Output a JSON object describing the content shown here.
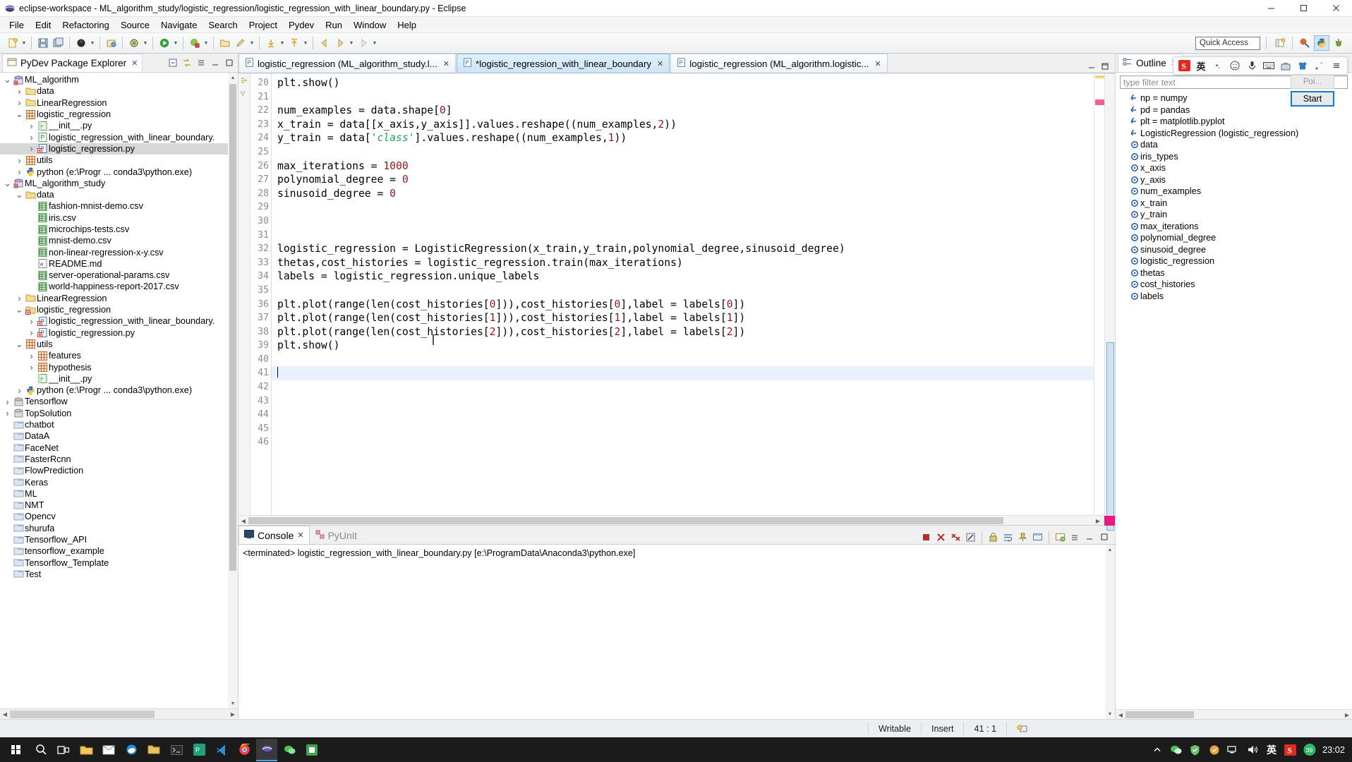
{
  "window": {
    "title": "eclipse-workspace - ML_algorithm_study/logistic_regression/logistic_regression_with_linear_boundary.py - Eclipse",
    "minimize": "–",
    "maximize": "□",
    "close": "✕"
  },
  "menubar": [
    "File",
    "Edit",
    "Refactoring",
    "Source",
    "Navigate",
    "Search",
    "Project",
    "Pydev",
    "Run",
    "Window",
    "Help"
  ],
  "toolbar": {
    "quick_access_placeholder": "Quick Access",
    "buttons": [
      "new-wizard-icon",
      "save-icon",
      "save-all-icon",
      "debug-icon",
      "run-external-tools-icon",
      "debug-run-icon",
      "run-icon",
      "coverage-icon",
      "open-folder-icon",
      "pin-icon",
      "next-annotation-icon",
      "previous-annotation-icon",
      "back-icon",
      "forward-icon"
    ],
    "perspectives": [
      "open-perspective-icon",
      "java-perspective-icon",
      "pydev-perspective-icon",
      "debug-perspective-icon"
    ]
  },
  "package_explorer": {
    "title": "PyDev Package Explorer",
    "close_x": "✕",
    "actions": [
      "collapse-all-icon",
      "link-with-editor-icon",
      "view-menu-icon",
      "minimize-icon",
      "maximize-icon"
    ],
    "items": [
      {
        "label": "ML_algorithm",
        "indent": 0,
        "arrow": "v",
        "icon": "pydev-project-icon",
        "selected": false
      },
      {
        "label": "data",
        "indent": 1,
        "arrow": ">",
        "icon": "folder-icon",
        "selected": false
      },
      {
        "label": "LinearRegression",
        "indent": 1,
        "arrow": ">",
        "icon": "folder-icon",
        "selected": false
      },
      {
        "label": "logistic_regression",
        "indent": 1,
        "arrow": "v",
        "icon": "package-icon",
        "selected": false
      },
      {
        "label": "__init__.py",
        "indent": 2,
        "arrow": ">",
        "icon": "python-init-icon",
        "selected": false
      },
      {
        "label": "logistic_regression_with_linear_boundary.",
        "indent": 2,
        "arrow": ">",
        "icon": "python-file-icon",
        "selected": false
      },
      {
        "label": "logistic_regression.py",
        "indent": 2,
        "arrow": ">",
        "icon": "python-error-icon",
        "selected": true
      },
      {
        "label": "utils",
        "indent": 1,
        "arrow": ">",
        "icon": "package-icon",
        "selected": false
      },
      {
        "label": "python  (e:\\Progr ... conda3\\python.exe)",
        "indent": 1,
        "arrow": ">",
        "icon": "python-interp-icon",
        "selected": false
      },
      {
        "label": "ML_algorithm_study",
        "indent": 0,
        "arrow": "v",
        "icon": "pydev-project-icon",
        "selected": false
      },
      {
        "label": "data",
        "indent": 1,
        "arrow": "v",
        "icon": "folder-icon",
        "selected": false
      },
      {
        "label": "fashion-mnist-demo.csv",
        "indent": 2,
        "arrow": "",
        "icon": "csv-icon",
        "selected": false
      },
      {
        "label": "iris.csv",
        "indent": 2,
        "arrow": "",
        "icon": "csv-icon",
        "selected": false
      },
      {
        "label": "microchips-tests.csv",
        "indent": 2,
        "arrow": "",
        "icon": "csv-icon",
        "selected": false
      },
      {
        "label": "mnist-demo.csv",
        "indent": 2,
        "arrow": "",
        "icon": "csv-icon",
        "selected": false
      },
      {
        "label": "non-linear-regression-x-y.csv",
        "indent": 2,
        "arrow": "",
        "icon": "csv-icon",
        "selected": false
      },
      {
        "label": "README.md",
        "indent": 2,
        "arrow": "",
        "icon": "md-icon",
        "selected": false
      },
      {
        "label": "server-operational-params.csv",
        "indent": 2,
        "arrow": "",
        "icon": "csv-icon",
        "selected": false
      },
      {
        "label": "world-happiness-report-2017.csv",
        "indent": 2,
        "arrow": "",
        "icon": "csv-icon",
        "selected": false
      },
      {
        "label": "LinearRegression",
        "indent": 1,
        "arrow": ">",
        "icon": "folder-icon",
        "selected": false
      },
      {
        "label": "logistic_regression",
        "indent": 1,
        "arrow": "v",
        "icon": "folder-error-icon",
        "selected": false
      },
      {
        "label": "logistic_regression_with_linear_boundary.",
        "indent": 2,
        "arrow": ">",
        "icon": "python-error-icon",
        "selected": false
      },
      {
        "label": "logistic_regression.py",
        "indent": 2,
        "arrow": ">",
        "icon": "python-error-icon",
        "selected": false
      },
      {
        "label": "utils",
        "indent": 1,
        "arrow": "v",
        "icon": "package-icon",
        "selected": false
      },
      {
        "label": "features",
        "indent": 2,
        "arrow": ">",
        "icon": "package-icon",
        "selected": false
      },
      {
        "label": "hypothesis",
        "indent": 2,
        "arrow": ">",
        "icon": "package-icon",
        "selected": false
      },
      {
        "label": "__init__.py",
        "indent": 2,
        "arrow": "",
        "icon": "python-init-icon",
        "selected": false
      },
      {
        "label": "python  (e:\\Progr ... conda3\\python.exe)",
        "indent": 1,
        "arrow": ">",
        "icon": "python-interp-icon",
        "selected": false
      },
      {
        "label": "Tensorflow",
        "indent": 0,
        "arrow": ">",
        "icon": "closed-project-icon",
        "selected": false
      },
      {
        "label": "TopSolution",
        "indent": 0,
        "arrow": ">",
        "icon": "closed-project-icon",
        "selected": false
      },
      {
        "label": "chatbot",
        "indent": 0,
        "arrow": "",
        "icon": "folder-plain-icon",
        "selected": false
      },
      {
        "label": "DataA",
        "indent": 0,
        "arrow": "",
        "icon": "folder-plain-icon",
        "selected": false
      },
      {
        "label": "FaceNet",
        "indent": 0,
        "arrow": "",
        "icon": "folder-plain-icon",
        "selected": false
      },
      {
        "label": "FasterRcnn",
        "indent": 0,
        "arrow": "",
        "icon": "folder-plain-icon",
        "selected": false
      },
      {
        "label": "FlowPrediction",
        "indent": 0,
        "arrow": "",
        "icon": "folder-plain-icon",
        "selected": false
      },
      {
        "label": "Keras",
        "indent": 0,
        "arrow": "",
        "icon": "folder-plain-icon",
        "selected": false
      },
      {
        "label": "ML",
        "indent": 0,
        "arrow": "",
        "icon": "folder-plain-icon",
        "selected": false
      },
      {
        "label": "NMT",
        "indent": 0,
        "arrow": "",
        "icon": "folder-plain-icon",
        "selected": false
      },
      {
        "label": "Opencv",
        "indent": 0,
        "arrow": "",
        "icon": "folder-plain-icon",
        "selected": false
      },
      {
        "label": "shurufa",
        "indent": 0,
        "arrow": "",
        "icon": "folder-plain-icon",
        "selected": false
      },
      {
        "label": "Tensorflow_API",
        "indent": 0,
        "arrow": "",
        "icon": "folder-plain-icon",
        "selected": false
      },
      {
        "label": "tensorflow_example",
        "indent": 0,
        "arrow": "",
        "icon": "folder-plain-icon",
        "selected": false
      },
      {
        "label": "Tensorflow_Template",
        "indent": 0,
        "arrow": "",
        "icon": "folder-plain-icon",
        "selected": false
      },
      {
        "label": "Test",
        "indent": 0,
        "arrow": "",
        "icon": "folder-plain-icon",
        "selected": false
      }
    ]
  },
  "editor": {
    "tabs": [
      {
        "label": "logistic_regression (ML_algorithm_study.l...",
        "active": false,
        "dirty": false,
        "close": "✕"
      },
      {
        "label": "*logistic_regression_with_linear_boundary",
        "active": true,
        "dirty": true,
        "close": "✕"
      },
      {
        "label": "logistic_regression (ML_algorithm.logistic...",
        "active": false,
        "dirty": false,
        "close": "✕"
      }
    ],
    "minimize": "—",
    "maximize": "□",
    "first_line_number": 20,
    "current_line": 41,
    "lines": [
      {
        "n": 20,
        "tokens": [
          {
            "t": "plt.show()",
            "c": ""
          }
        ]
      },
      {
        "n": 21,
        "tokens": []
      },
      {
        "n": 22,
        "tokens": [
          {
            "t": "num_examples = data.shape[",
            "c": ""
          },
          {
            "t": "0",
            "c": "num"
          },
          {
            "t": "]",
            "c": ""
          }
        ]
      },
      {
        "n": 23,
        "tokens": [
          {
            "t": "x_train = data[[x_axis,y_axis]].values.reshape((num_examples,",
            "c": ""
          },
          {
            "t": "2",
            "c": "num"
          },
          {
            "t": "))",
            "c": ""
          }
        ]
      },
      {
        "n": 24,
        "tokens": [
          {
            "t": "y_train = data[",
            "c": ""
          },
          {
            "t": "'class'",
            "c": "str"
          },
          {
            "t": "].values.reshape((num_examples,",
            "c": ""
          },
          {
            "t": "1",
            "c": "num"
          },
          {
            "t": "))",
            "c": ""
          }
        ]
      },
      {
        "n": 25,
        "tokens": []
      },
      {
        "n": 26,
        "tokens": [
          {
            "t": "max_iterations = ",
            "c": ""
          },
          {
            "t": "1000",
            "c": "num"
          }
        ]
      },
      {
        "n": 27,
        "tokens": [
          {
            "t": "polynomial_degree = ",
            "c": ""
          },
          {
            "t": "0",
            "c": "num"
          }
        ]
      },
      {
        "n": 28,
        "tokens": [
          {
            "t": "sinusoid_degree = ",
            "c": ""
          },
          {
            "t": "0",
            "c": "num"
          }
        ]
      },
      {
        "n": 29,
        "tokens": []
      },
      {
        "n": 30,
        "tokens": []
      },
      {
        "n": 31,
        "tokens": []
      },
      {
        "n": 32,
        "tokens": [
          {
            "t": "logistic_regression = LogisticRegression(x_train,y_train,polynomial_degree,sinusoid_degree)",
            "c": ""
          }
        ]
      },
      {
        "n": 33,
        "tokens": [
          {
            "t": "thetas,cost_histories = logistic_regression.train(max_iterations)",
            "c": ""
          }
        ]
      },
      {
        "n": 34,
        "tokens": [
          {
            "t": "labels = logistic_regression.unique_labels",
            "c": ""
          }
        ]
      },
      {
        "n": 35,
        "tokens": []
      },
      {
        "n": 36,
        "tokens": [
          {
            "t": "plt.plot(range(len(cost_histories[",
            "c": ""
          },
          {
            "t": "0",
            "c": "num"
          },
          {
            "t": "])),cost_histories[",
            "c": ""
          },
          {
            "t": "0",
            "c": "num"
          },
          {
            "t": "],label = labels[",
            "c": ""
          },
          {
            "t": "0",
            "c": "num"
          },
          {
            "t": "])",
            "c": ""
          }
        ]
      },
      {
        "n": 37,
        "tokens": [
          {
            "t": "plt.plot(range(len(cost_histories[",
            "c": ""
          },
          {
            "t": "1",
            "c": "num"
          },
          {
            "t": "])),cost_histories[",
            "c": ""
          },
          {
            "t": "1",
            "c": "num"
          },
          {
            "t": "],label = labels[",
            "c": ""
          },
          {
            "t": "1",
            "c": "num"
          },
          {
            "t": "])",
            "c": ""
          }
        ]
      },
      {
        "n": 38,
        "tokens": [
          {
            "t": "plt.plot(range(len(cost_histories[",
            "c": ""
          },
          {
            "t": "2",
            "c": "num"
          },
          {
            "t": "])),cost_histories[",
            "c": ""
          },
          {
            "t": "2",
            "c": "num"
          },
          {
            "t": "],label = labels[",
            "c": ""
          },
          {
            "t": "2",
            "c": "num"
          },
          {
            "t": "])",
            "c": ""
          }
        ]
      },
      {
        "n": 39,
        "tokens": [
          {
            "t": "plt.show()",
            "c": ""
          }
        ]
      },
      {
        "n": 40,
        "tokens": []
      },
      {
        "n": 41,
        "tokens": [],
        "current": true
      },
      {
        "n": 42,
        "tokens": []
      },
      {
        "n": 43,
        "tokens": []
      },
      {
        "n": 44,
        "tokens": []
      },
      {
        "n": 45,
        "tokens": []
      },
      {
        "n": 46,
        "tokens": []
      }
    ]
  },
  "console": {
    "tabs": [
      {
        "label": "Console",
        "active": true,
        "close": "✕",
        "icon": "console-icon"
      },
      {
        "label": "PyUnit",
        "active": false,
        "close": "",
        "icon": "pyunit-icon"
      }
    ],
    "actions": [
      "terminate-icon",
      "remove-launch-icon",
      "remove-all-icon",
      "clear-console-icon",
      "scroll-lock-icon",
      "word-wrap-icon",
      "pin-console-icon",
      "display-console-icon",
      "open-console-icon",
      "view-menu-icon",
      "minimize-icon",
      "maximize-icon"
    ],
    "output": "<terminated> logistic_regression_with_linear_boundary.py [e:\\ProgramData\\Anaconda3\\python.exe]"
  },
  "outline": {
    "title": "Outline",
    "close_x": "✕",
    "filter_placeholder": "type filter text",
    "items": [
      {
        "label": "np = numpy",
        "icon": "import-icon"
      },
      {
        "label": "pd = pandas",
        "icon": "import-icon"
      },
      {
        "label": "plt = matplotlib.pyplot",
        "icon": "import-icon"
      },
      {
        "label": "LogisticRegression (logistic_regression)",
        "icon": "import-icon"
      },
      {
        "label": "data",
        "icon": "attribute-icon"
      },
      {
        "label": "iris_types",
        "icon": "attribute-icon"
      },
      {
        "label": "x_axis",
        "icon": "attribute-icon"
      },
      {
        "label": "y_axis",
        "icon": "attribute-icon"
      },
      {
        "label": "num_examples",
        "icon": "attribute-icon"
      },
      {
        "label": "x_train",
        "icon": "attribute-icon"
      },
      {
        "label": "y_train",
        "icon": "attribute-icon"
      },
      {
        "label": "max_iterations",
        "icon": "attribute-icon"
      },
      {
        "label": "polynomial_degree",
        "icon": "attribute-icon"
      },
      {
        "label": "sinusoid_degree",
        "icon": "attribute-icon"
      },
      {
        "label": "logistic_regression",
        "icon": "attribute-icon"
      },
      {
        "label": "thetas",
        "icon": "attribute-icon"
      },
      {
        "label": "cost_histories",
        "icon": "attribute-icon"
      },
      {
        "label": "labels",
        "icon": "attribute-icon"
      }
    ]
  },
  "ime": {
    "icons": [
      "sogou-logo-icon",
      "language-en-icon",
      "more-icon",
      "emoji-icon",
      "microphone-icon",
      "keyboard-icon",
      "toolbox-icon",
      "skin-icon",
      "settings-icon",
      "menu-icon"
    ],
    "language": "英"
  },
  "tooltip": {
    "top_text": "Poi...",
    "button_label": "Start"
  },
  "statusbar": {
    "writable": "Writable",
    "insert": "Insert",
    "position": "41 : 1",
    "icon": "smart-insert-icon"
  },
  "taskbar": {
    "start_icon": "windows-start-icon",
    "items": [
      "search-icon",
      "task-view-icon",
      "file-explorer-icon",
      "mail-icon",
      "edge-icon",
      "folder-icon",
      "terminal-icon",
      "pycharm-icon",
      "vscode-icon",
      "chrome-icon",
      "eclipse-icon",
      "wechat-icon",
      "green-app-icon"
    ],
    "tray": [
      "wechat-tray-icon",
      "shield-icon",
      "update-icon",
      "network-icon",
      "volume-icon"
    ],
    "ime_lang": "英",
    "sogou": "S",
    "badge": "39",
    "clock": "23:02"
  },
  "colors": {
    "accent": "#0a7fd4",
    "tab_active": "#cde5f7",
    "selection": "#d7d7d7",
    "current_line": "#e8f2fe",
    "string": "#2a9d5c",
    "number": "#8b1a1a",
    "keyword": "#7f0055",
    "ruler_yellow": "#f2d86a",
    "ruler_pink": "#f06090"
  }
}
